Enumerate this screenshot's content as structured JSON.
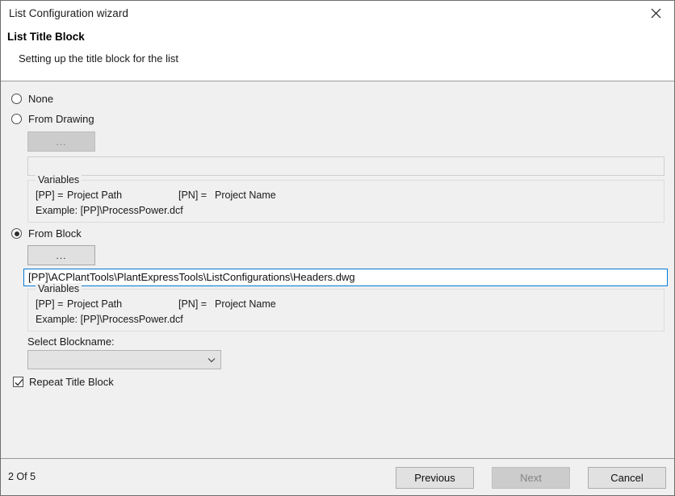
{
  "window": {
    "title": "List Configuration wizard",
    "close_icon": "close-icon"
  },
  "header": {
    "title": "List Title Block",
    "subtitle": "Setting up the title block for the list"
  },
  "options": {
    "none": {
      "label": "None",
      "selected": false
    },
    "from_drawing": {
      "label": "From Drawing",
      "selected": false
    },
    "from_block": {
      "label": "From Block",
      "selected": true
    }
  },
  "drawing_section": {
    "browse_label": "...",
    "path_value": "",
    "path_placeholder": "",
    "variables": {
      "legend": "Variables",
      "pp_key": "[PP] =",
      "pp_value": "Project Path",
      "pn_key": "[PN] =",
      "pn_value": "Project Name",
      "example": "Example: [PP]\\ProcessPower.dcf"
    }
  },
  "block_section": {
    "browse_label": "...",
    "path_value": "[PP]\\ACPlantTools\\PlantExpressTools\\ListConfigurations\\Headers.dwg",
    "path_placeholder": "",
    "variables": {
      "legend": "Variables",
      "pp_key": "[PP] =",
      "pp_value": "Project Path",
      "pn_key": "[PN] =",
      "pn_value": "Project Name",
      "example": "Example: [PP]\\ProcessPower.dcf"
    },
    "blockname_label": "Select Blockname:",
    "blockname_value": "",
    "blockname_arrow_icon": "chevron-down-icon",
    "repeat_title_block": {
      "label": "Repeat Title Block",
      "checked": true
    }
  },
  "footer": {
    "page_indicator": "2 Of 5",
    "previous_label": "Previous",
    "next_label": "Next",
    "next_disabled": true,
    "cancel_label": "Cancel"
  },
  "colors": {
    "accent": "#0078d7",
    "body_bg": "#f0f0f0",
    "header_bg": "#ffffff",
    "border": "#9a9a9a"
  }
}
